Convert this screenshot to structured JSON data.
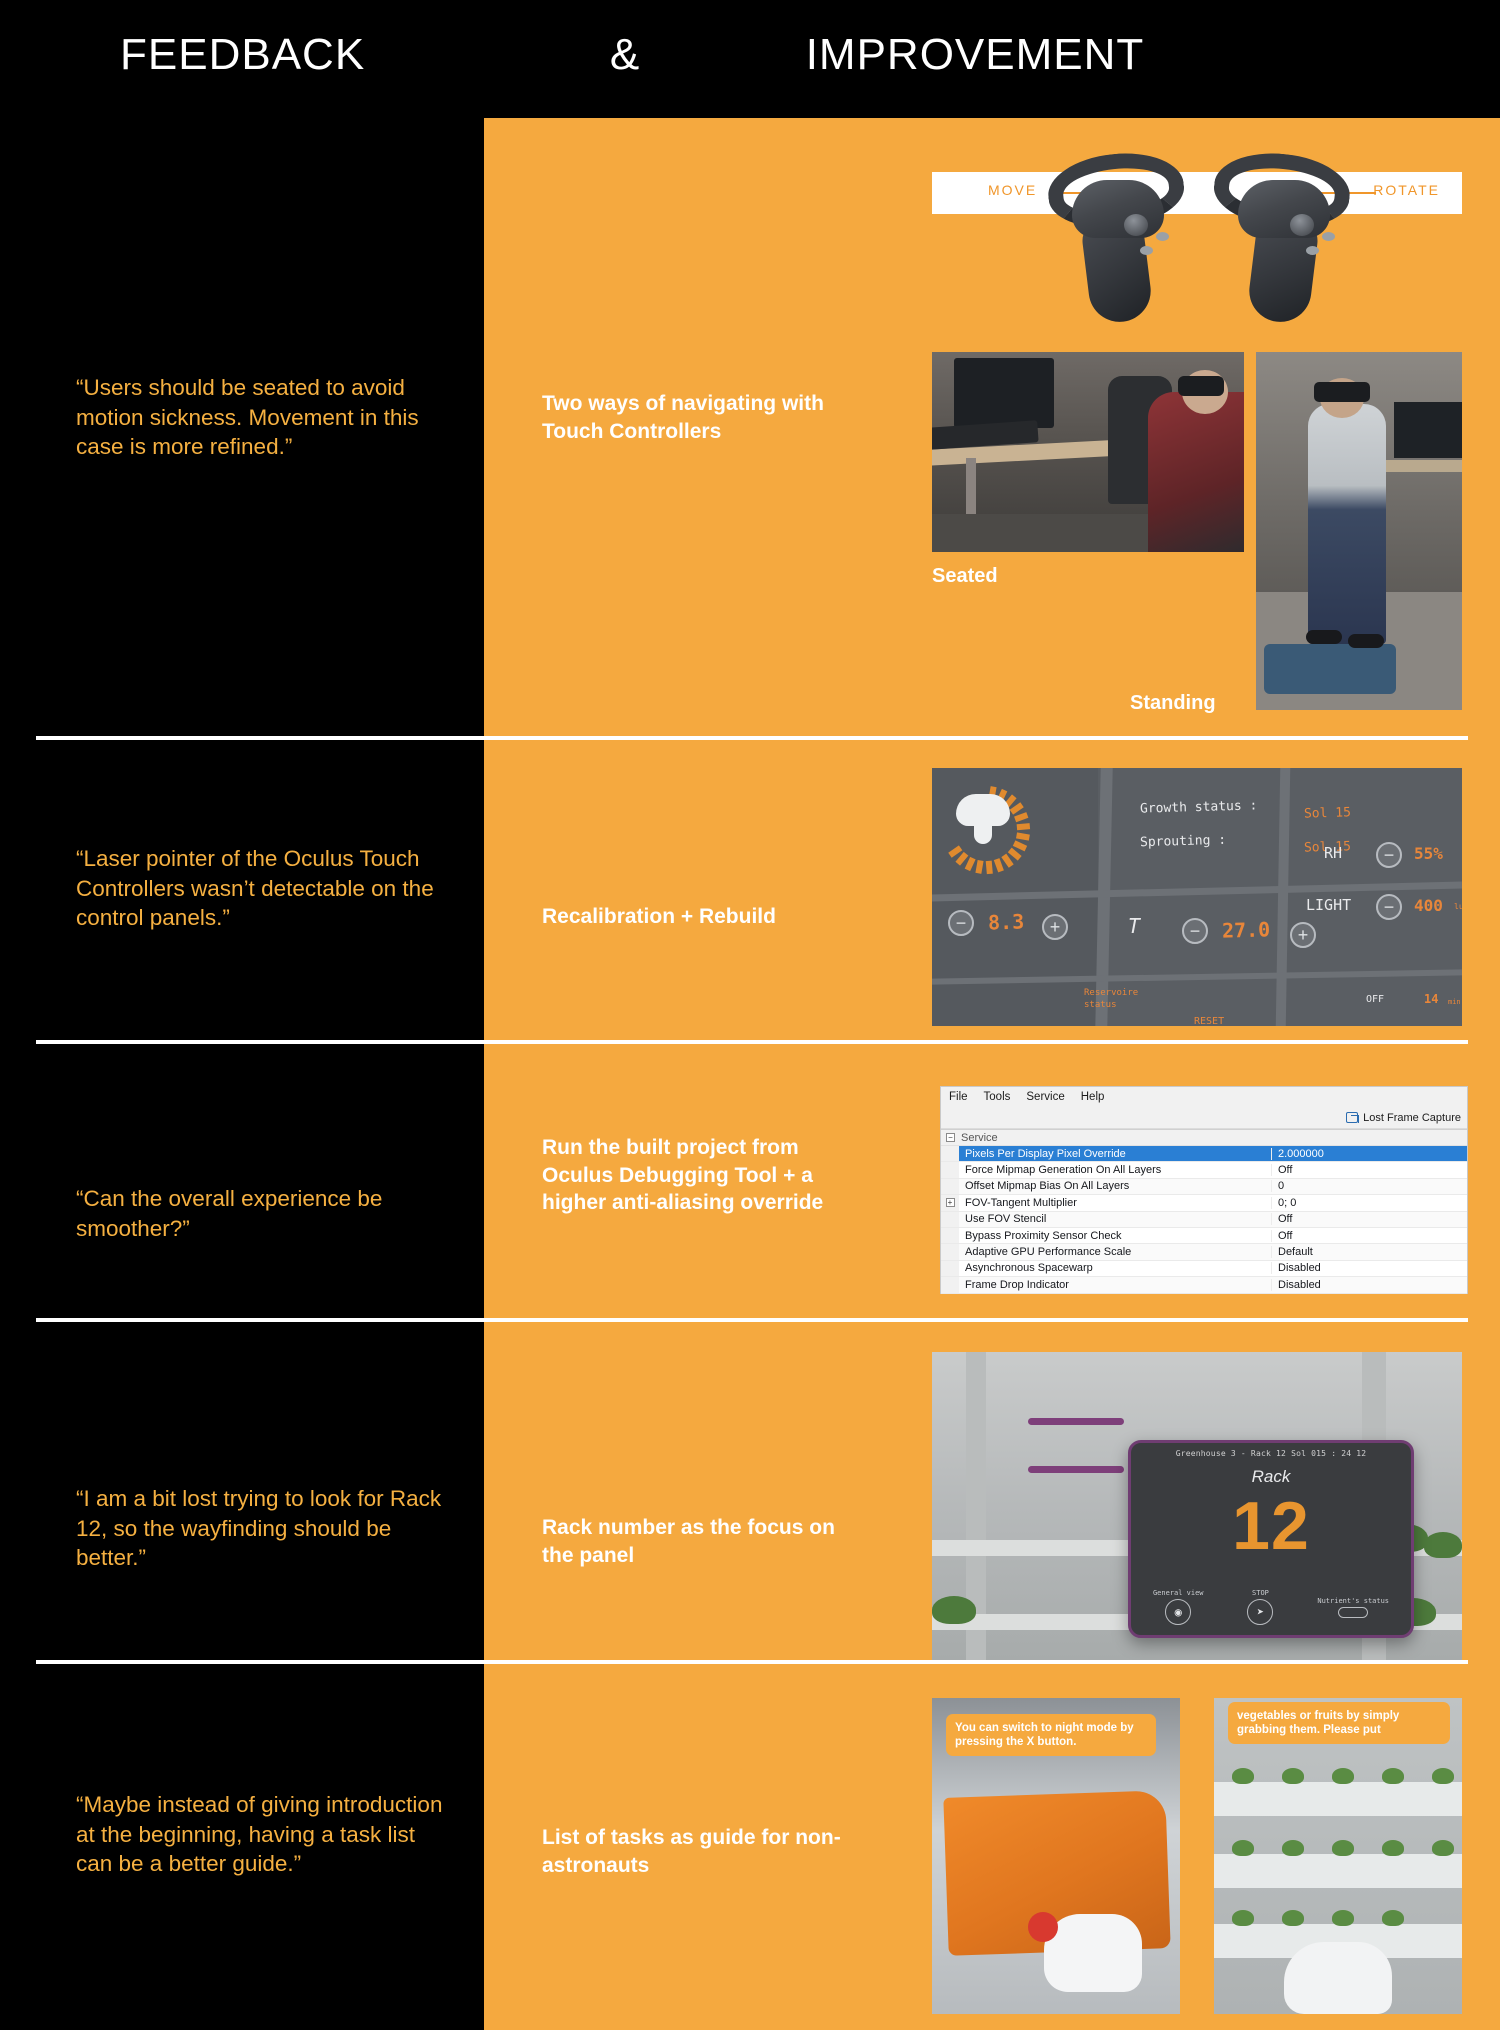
{
  "header": {
    "title_left": "FEEDBACK",
    "title_amp": "&",
    "title_right": "IMPROVEMENT"
  },
  "rows": [
    {
      "quote": "“Users should be seated to avoid motion sickness. Movement in this case is more refined.”",
      "headline": "Two ways of navigating with Touch Controllers",
      "media": {
        "controller_labels": {
          "left": "MOVE",
          "right": "ROTATE"
        },
        "photo_captions": {
          "seated": "Seated",
          "standing": "Standing"
        }
      }
    },
    {
      "quote": "“Laser pointer of the Oculus Touch Controllers wasn’t detectable on the control panels.”",
      "headline": "Recalibration + Rebuild",
      "media": {
        "panel_labels": {
          "growth_status_label": "Growth status :",
          "growth_status_value": "Sol 15",
          "sprouting_label": "Sprouting :",
          "sprouting_value": "Sol 15",
          "ph_value": "8.3",
          "temp_symbol": "T",
          "temp_value": "27.0",
          "rh_label": "RH",
          "rh_value": "55%",
          "light_label": "LIGHT",
          "light_value": "400",
          "light_unit": "lux",
          "reservoire_label": "Reservoire status",
          "reset_label": "RESET",
          "off_label": "OFF",
          "dial_value": "14",
          "dial_unit": "min",
          "minus": "−",
          "plus": "+"
        }
      }
    },
    {
      "quote": "“Can the overall experience be smoother?”",
      "headline": "Run the built project from Oculus Debugging Tool + a higher anti-aliasing override",
      "media": {
        "window": {
          "menu": [
            "File",
            "Tools",
            "Service",
            "Help"
          ],
          "toolbar_button": "Lost Frame Capture",
          "group_label": "Service",
          "rows": [
            {
              "name": "Pixels Per Display Pixel Override",
              "value": "2.000000",
              "selected": true,
              "expandable": false
            },
            {
              "name": "Force Mipmap Generation On All Layers",
              "value": "Off",
              "selected": false,
              "expandable": false
            },
            {
              "name": "Offset Mipmap Bias On All Layers",
              "value": "0",
              "selected": false,
              "expandable": false
            },
            {
              "name": "FOV-Tangent Multiplier",
              "value": "0; 0",
              "selected": false,
              "expandable": true
            },
            {
              "name": "Use FOV Stencil",
              "value": "Off",
              "selected": false,
              "expandable": false
            },
            {
              "name": "Bypass Proximity Sensor Check",
              "value": "Off",
              "selected": false,
              "expandable": false
            },
            {
              "name": "Adaptive GPU Performance Scale",
              "value": "Default",
              "selected": false,
              "expandable": false
            },
            {
              "name": "Asynchronous Spacewarp",
              "value": "Disabled",
              "selected": false,
              "expandable": false
            },
            {
              "name": "Frame Drop Indicator",
              "value": "Disabled",
              "selected": false,
              "expandable": false
            }
          ]
        }
      }
    },
    {
      "quote": "“I am a bit lost trying to look for Rack 12, so the wayfinding should be better.”",
      "headline": "Rack number as the focus on the panel",
      "media": {
        "panel": {
          "window_title": "Greenhouse 3 - Rack 12 Sol 015 : 24 12",
          "label": "Rack",
          "number": "12",
          "footer_left": "General view",
          "footer_center": "STOP",
          "footer_right": "Nutrient's status"
        }
      }
    },
    {
      "quote": "“Maybe instead of giving introduction at the beginning, having a task list can be a better guide.”",
      "headline": "List of tasks as guide for non-astronauts",
      "media": {
        "tips": [
          "You can switch to night mode by pressing the X button.",
          "vegetables or fruits by simply grabbing them. Please put"
        ]
      }
    }
  ],
  "colors": {
    "background": "#000000",
    "accent_orange": "#f5a93f",
    "quote_orange": "#f5b041",
    "white": "#ffffff",
    "panel_value_orange": "#e8863a"
  }
}
